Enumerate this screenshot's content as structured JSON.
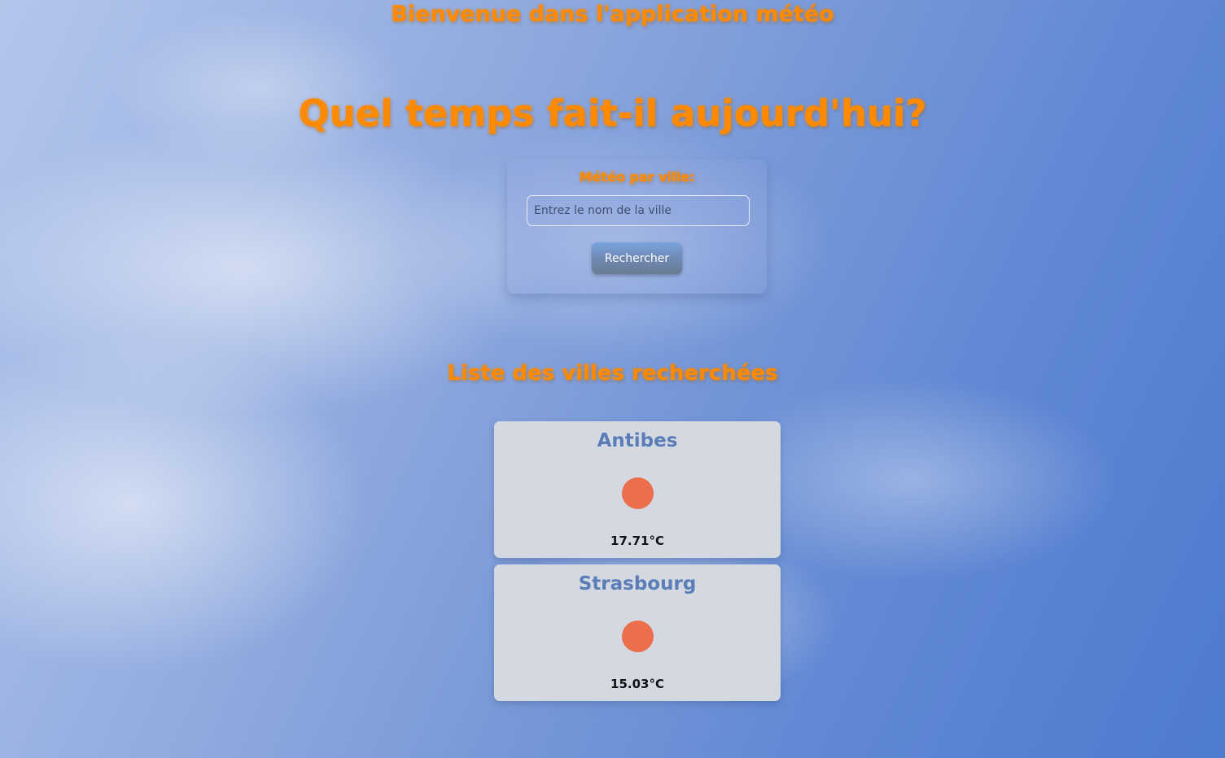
{
  "header": {
    "welcome": "Bienvenue dans l'application météo",
    "headline": "Quel temps fait-il aujourd'hui?"
  },
  "search": {
    "label": "Météo par ville:",
    "placeholder": "Entrez le nom de la ville",
    "value": "",
    "button_label": "Rechercher"
  },
  "list": {
    "title": "Liste des villes recherchées",
    "cities": [
      {
        "name": "Antibes",
        "temperature": "17.71°C",
        "icon": "sun-icon"
      },
      {
        "name": "Strasbourg",
        "temperature": "15.03°C",
        "icon": "sun-icon"
      }
    ]
  },
  "colors": {
    "accent": "#ff8a00",
    "city_name": "#5a7db8",
    "sun": "#ec6e4b",
    "card_background": "#d4d8e0"
  }
}
